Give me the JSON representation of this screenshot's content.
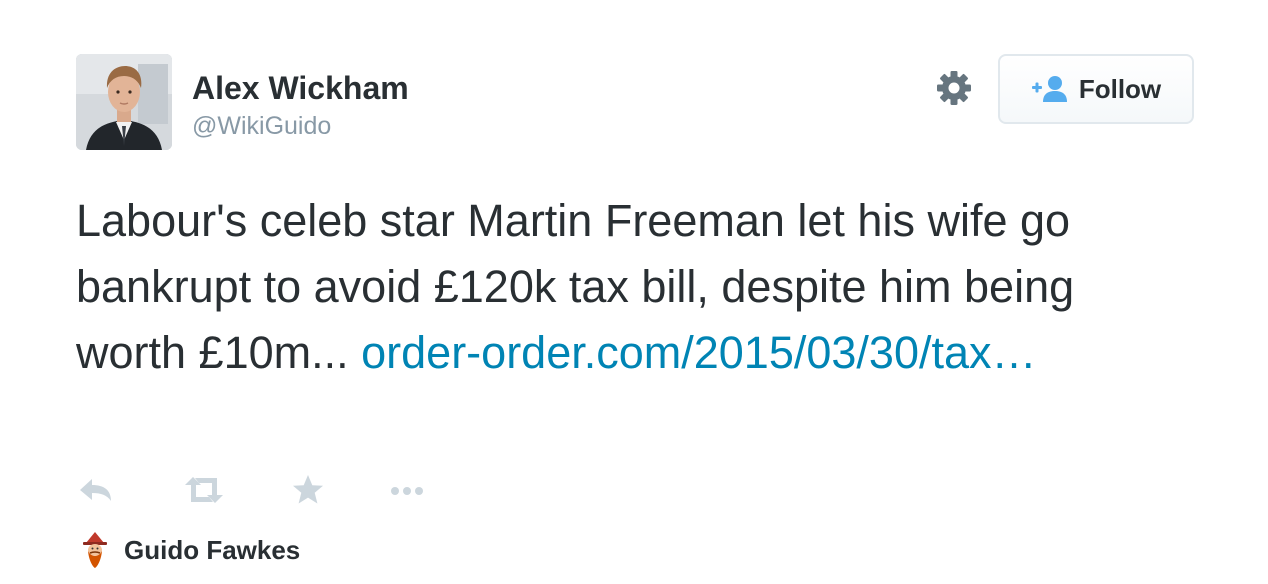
{
  "author": {
    "name": "Alex Wickham",
    "handle": "@WikiGuido",
    "avatar_icon": "profile-photo"
  },
  "header": {
    "settings_icon": "gear-icon",
    "follow_button": {
      "label": "Follow",
      "icon": "add-user-icon",
      "accent": "#55acee"
    }
  },
  "tweet": {
    "text": "Labour's celeb star Martin Freeman let his wife go bankrupt to avoid £120k tax bill, despite him being worth £10m... ",
    "link_text": "order-order.com/2015/03/30/tax…",
    "link_color": "#0084b4"
  },
  "actions": [
    {
      "name": "reply",
      "icon": "reply-icon"
    },
    {
      "name": "retweet",
      "icon": "retweet-icon"
    },
    {
      "name": "favorite",
      "icon": "star-icon"
    },
    {
      "name": "more",
      "icon": "more-icon"
    }
  ],
  "source": {
    "name": "Guido Fawkes",
    "icon": "guido-fawkes-logo"
  },
  "colors": {
    "text": "#292f33",
    "muted": "#8899a6",
    "icon_gray": "#ccd6dd",
    "link": "#0084b4"
  }
}
